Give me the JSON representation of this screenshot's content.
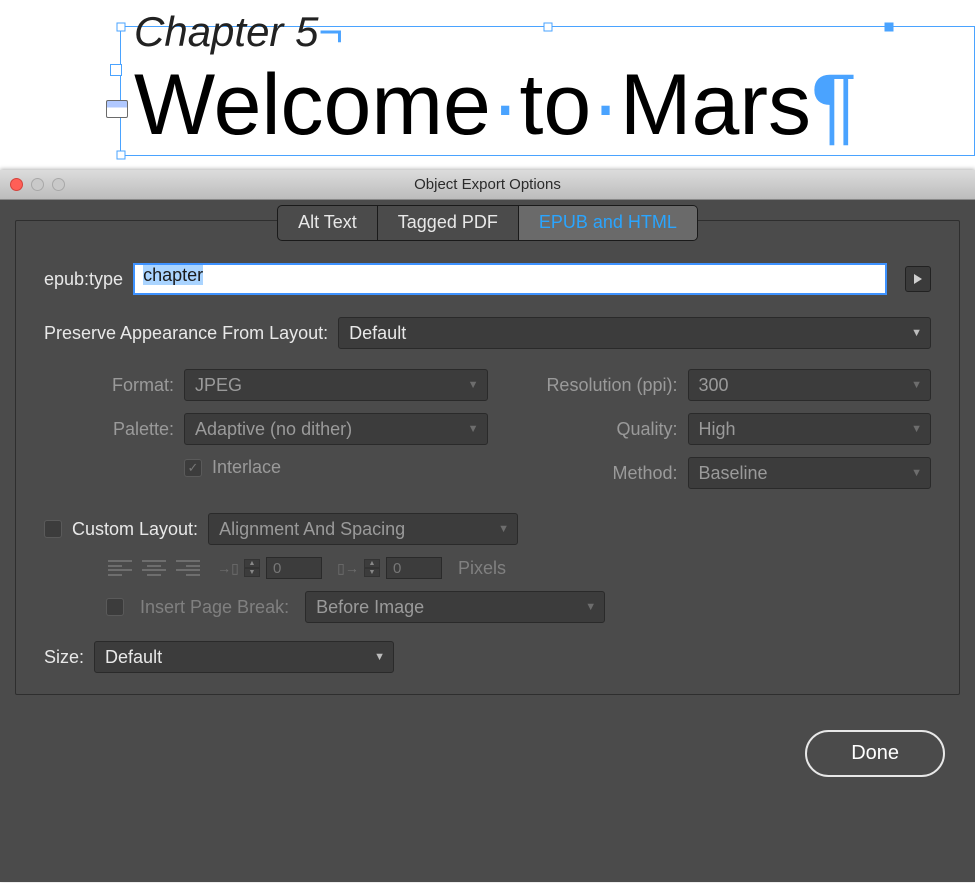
{
  "doc": {
    "chapter_label": "Chapter 5",
    "title_words": [
      "Welcome",
      "to",
      "Mars"
    ]
  },
  "dialog": {
    "title": "Object Export Options",
    "tabs": {
      "alt": "Alt Text",
      "pdf": "Tagged PDF",
      "epub": "EPUB and HTML"
    },
    "epub_type_label": "epub:type",
    "epub_type_value": "chapter",
    "preserve_label": "Preserve Appearance From Layout:",
    "preserve_value": "Default",
    "format_label": "Format:",
    "format_value": "JPEG",
    "resolution_label": "Resolution (ppi):",
    "resolution_value": "300",
    "palette_label": "Palette:",
    "palette_value": "Adaptive (no dither)",
    "quality_label": "Quality:",
    "quality_value": "High",
    "interlace_label": "Interlace",
    "method_label": "Method:",
    "method_value": "Baseline",
    "custom_layout_label": "Custom Layout:",
    "custom_layout_value": "Alignment And Spacing",
    "before_value": "0",
    "after_value": "0",
    "space_unit": "Pixels",
    "insert_break_label": "Insert Page Break:",
    "insert_break_value": "Before Image",
    "size_label": "Size:",
    "size_value": "Default",
    "done": "Done"
  }
}
